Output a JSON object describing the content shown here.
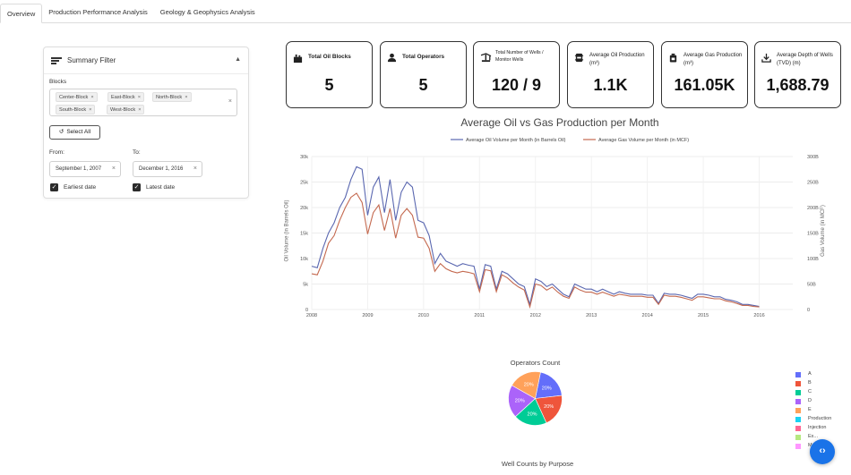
{
  "tabs": [
    "Overview",
    "Production Performance Analysis",
    "Geology & Geophysics Analysis"
  ],
  "filter": {
    "title": "Summary Filter",
    "blocks_label": "Blocks",
    "blocks": [
      "Center-Block",
      "East-Block",
      "North-Block",
      "South-Block",
      "West-Block"
    ],
    "select_all": "Select All",
    "from_label": "From:",
    "to_label": "To:",
    "from_date": "September 1, 2007",
    "to_date": "December 1, 2016",
    "earliest_label": "Earliest date",
    "latest_label": "Latest date"
  },
  "kpis": [
    {
      "title": "Total Oil Blocks",
      "value": "5",
      "icon": "oil-block-icon"
    },
    {
      "title": "Total Operators",
      "value": "5",
      "icon": "operator-icon"
    },
    {
      "title": "Total Number of Wells / Monitor Wells",
      "value": "120 / 9",
      "icon": "well-pump-icon"
    },
    {
      "title": "Average Oil Production (m³)",
      "value": "1.1K",
      "icon": "oil-barrel-icon"
    },
    {
      "title": "Average Gas Production (m³)",
      "value": "161.05K",
      "icon": "gas-can-icon"
    },
    {
      "title": "Average Depth of Wells (TVD) (m)",
      "value": "1,688.79",
      "icon": "depth-icon"
    }
  ],
  "chart_data": [
    {
      "type": "line",
      "title": "Average Oil vs Gas Production per Month",
      "ylabel": "Oil Volume (in Barrels Oil)",
      "y2label": "Gas Volume (in MCF)",
      "ylim": [
        0,
        30000
      ],
      "y2lim": [
        0,
        300000
      ],
      "yticks": [
        "0",
        "5k",
        "10k",
        "15k",
        "20k",
        "25k",
        "30k"
      ],
      "y2ticks": [
        "0",
        "50B",
        "100B",
        "150B",
        "200B",
        "250B",
        "300B"
      ],
      "xticks": [
        "2008",
        "2009",
        "2010",
        "2011",
        "2012",
        "2013",
        "2014",
        "2015",
        "2016"
      ],
      "x": [
        2008.0,
        2008.1,
        2008.2,
        2008.3,
        2008.4,
        2008.5,
        2008.6,
        2008.7,
        2008.8,
        2008.9,
        2009.0,
        2009.1,
        2009.2,
        2009.3,
        2009.4,
        2009.5,
        2009.6,
        2009.7,
        2009.8,
        2009.9,
        2010.0,
        2010.1,
        2010.2,
        2010.3,
        2010.4,
        2010.5,
        2010.6,
        2010.7,
        2010.8,
        2010.9,
        2011.0,
        2011.1,
        2011.2,
        2011.3,
        2011.4,
        2011.5,
        2011.6,
        2011.7,
        2011.8,
        2011.9,
        2012.0,
        2012.1,
        2012.2,
        2012.3,
        2012.4,
        2012.5,
        2012.6,
        2012.7,
        2012.8,
        2012.9,
        2013.0,
        2013.1,
        2013.2,
        2013.3,
        2013.4,
        2013.5,
        2013.6,
        2013.7,
        2013.8,
        2013.9,
        2014.0,
        2014.1,
        2014.2,
        2014.3,
        2014.4,
        2014.5,
        2014.6,
        2014.7,
        2014.8,
        2014.9,
        2015.0,
        2015.1,
        2015.2,
        2015.3,
        2015.4,
        2015.5,
        2015.6,
        2015.7,
        2015.8,
        2015.9,
        2016.0,
        2016.1,
        2016.2,
        2016.3,
        2016.4,
        2016.5,
        2016.6
      ],
      "series": [
        {
          "name": "Average Oil Volume per Month (in Barrels Oil)",
          "color": "#5a67b0",
          "values": [
            8500,
            8200,
            12000,
            15000,
            17000,
            20000,
            22000,
            25500,
            28000,
            27500,
            18500,
            24000,
            26000,
            19000,
            25500,
            17500,
            23000,
            25000,
            24000,
            17500,
            17000,
            14500,
            9000,
            11000,
            9500,
            9000,
            8500,
            9000,
            8700,
            8500,
            4000,
            8800,
            8500,
            4000,
            7500,
            7000,
            6000,
            5000,
            4500,
            1000,
            6000,
            5500,
            4500,
            5000,
            4000,
            3000,
            2500,
            5000,
            4500,
            4000,
            4000,
            3500,
            4000,
            3500,
            3000,
            3500,
            3200,
            3000,
            3000,
            3000,
            2800,
            2800,
            1200,
            3200,
            3000,
            3000,
            2800,
            2500,
            2200,
            3000,
            3000,
            2800,
            2500,
            2500,
            2000,
            1800,
            1500,
            1000,
            1000,
            800,
            600
          ]
        },
        {
          "name": "Average Gas Volume per Month (in MCF)",
          "color": "#c4694f",
          "values": [
            70000,
            68000,
            95000,
            130000,
            145000,
            175000,
            200000,
            220000,
            228000,
            210000,
            148000,
            190000,
            205000,
            155000,
            198000,
            140000,
            185000,
            198000,
            185000,
            142000,
            140000,
            120000,
            75000,
            90000,
            80000,
            75000,
            72000,
            75000,
            73000,
            70000,
            35000,
            78000,
            76000,
            35000,
            68000,
            62000,
            52000,
            44000,
            38000,
            5000,
            50000,
            47000,
            38000,
            44000,
            34000,
            26000,
            22000,
            44000,
            38000,
            34000,
            34000,
            30000,
            34000,
            30000,
            26000,
            30000,
            28000,
            26000,
            26000,
            26000,
            24000,
            24000,
            10000,
            28000,
            26000,
            26000,
            24000,
            21000,
            18000,
            25000,
            25000,
            23000,
            21000,
            21000,
            17000,
            15000,
            12000,
            8000,
            8000,
            6000,
            5000
          ]
        }
      ]
    },
    {
      "type": "pie",
      "title": "Operators Count",
      "categories": [
        "A",
        "B",
        "C",
        "D",
        "E"
      ],
      "values": [
        20,
        20,
        20,
        20,
        20
      ],
      "labels": [
        "20%",
        "20%",
        "20%",
        "20%",
        "20%"
      ],
      "colors": [
        "#636efa",
        "#ef553b",
        "#00cc96",
        "#ab63fa",
        "#ffa15a"
      ]
    }
  ],
  "legend_items": [
    {
      "label": "A",
      "color": "#636efa"
    },
    {
      "label": "B",
      "color": "#ef553b"
    },
    {
      "label": "C",
      "color": "#00cc96"
    },
    {
      "label": "D",
      "color": "#ab63fa"
    },
    {
      "label": "E",
      "color": "#ffa15a"
    },
    {
      "label": "Production",
      "color": "#19d3f3"
    },
    {
      "label": "Injection",
      "color": "#ff6692"
    },
    {
      "label": "Ex...",
      "color": "#b6e880"
    },
    {
      "label": "M...",
      "color": "#ff97ff"
    }
  ],
  "bottom_title": "Well Counts by Purpose",
  "fab_label": "‹›"
}
